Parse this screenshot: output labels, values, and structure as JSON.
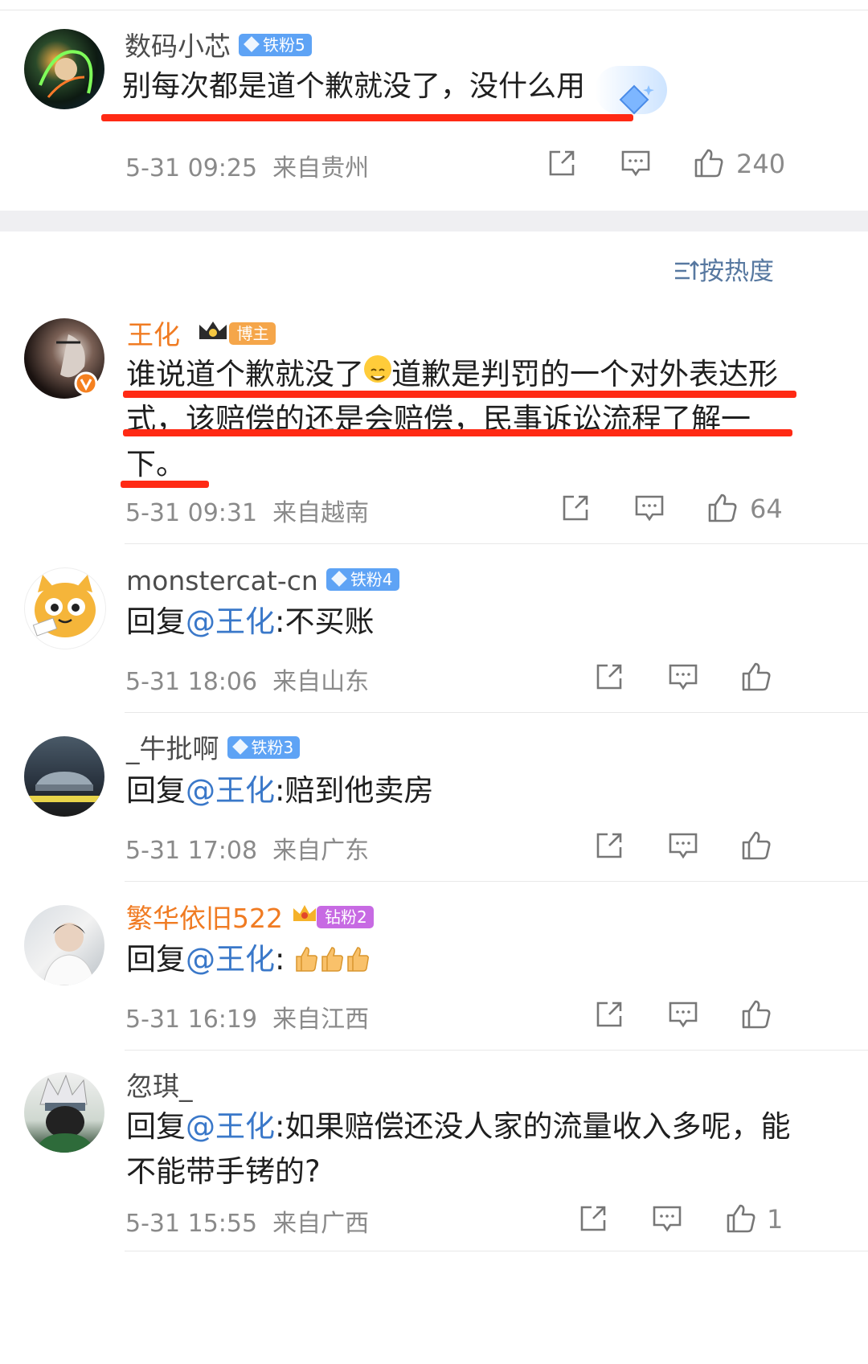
{
  "sort": {
    "label": "按热度"
  },
  "top_comment": {
    "username": "数码小芯",
    "badge": "铁粉5",
    "text": "别每次都是道个歉就没了，没什么用",
    "time": "5-31 09:25",
    "location": "来自贵州",
    "likes": "240"
  },
  "comments": [
    {
      "username": "王化",
      "badge": "博主",
      "text_part1": "谁说道个歉就没了",
      "text_line1_rest": "道歉是判罚的一个对外表达形",
      "text_line2": "式，该赔偿的还是会赔偿，民事诉讼流程了解一",
      "text_line3": "下。",
      "time": "5-31 09:31",
      "location": "来自越南",
      "likes": "64"
    },
    {
      "username": "monstercat-cn",
      "badge": "铁粉4",
      "reply_prefix": "回复",
      "mention": "@王化",
      "text": ":不买账",
      "time": "5-31 18:06",
      "location": "来自山东"
    },
    {
      "username": "_牛批啊",
      "badge": "铁粉3",
      "reply_prefix": "回复",
      "mention": "@王化",
      "text": ":赔到他卖房",
      "time": "5-31 17:08",
      "location": "来自广东"
    },
    {
      "username": "繁华依旧522",
      "badge": "钻粉2",
      "reply_prefix": "回复",
      "mention": "@王化",
      "text": ":",
      "time": "5-31 16:19",
      "location": "来自江西"
    },
    {
      "username": "忽琪_",
      "reply_prefix": "回复",
      "mention": "@王化",
      "text_line1": ":如果赔偿还没人家的流量收入多呢，能",
      "text_line2": "不能带手铐的?",
      "time": "5-31 15:55",
      "location": "来自广西",
      "likes": "1"
    }
  ],
  "colors": {
    "highlight_underline": "#ff2a14",
    "mention": "#3a78c9",
    "vip_name": "#f07b22",
    "badge_blue": "#5ea3f5",
    "badge_purple": "#c76ae3"
  },
  "icons": [
    "share-icon",
    "comment-icon",
    "like-icon",
    "crown-icon",
    "verified-icon",
    "sort-icon"
  ]
}
